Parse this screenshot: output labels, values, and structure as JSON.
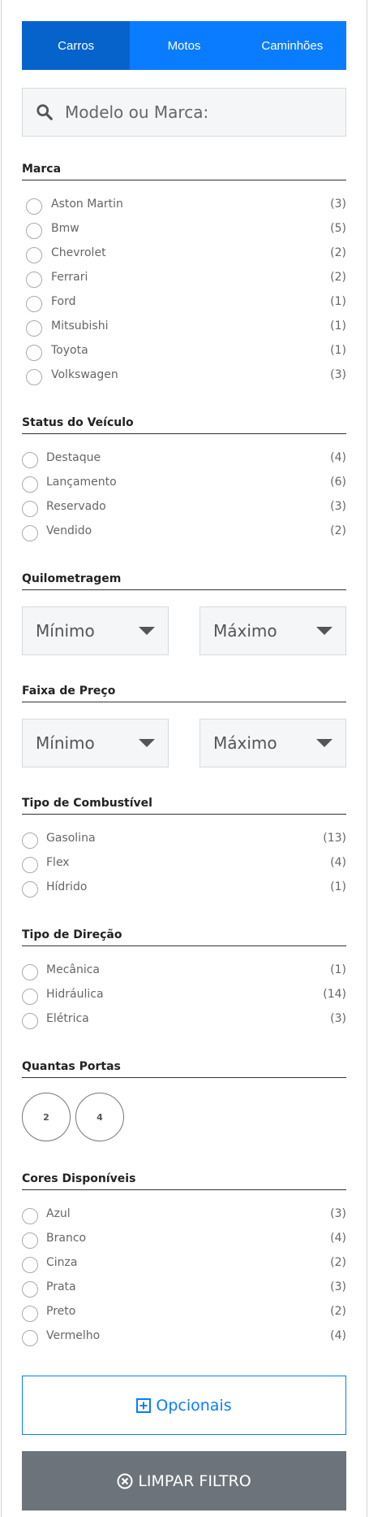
{
  "tabs": [
    {
      "label": "Carros",
      "active": true
    },
    {
      "label": "Motos",
      "active": false
    },
    {
      "label": "Caminhões",
      "active": false
    }
  ],
  "search": {
    "placeholder": "Modelo ou Marca:"
  },
  "sections": {
    "marca": {
      "title": "Marca",
      "items": [
        {
          "label": "Aston Martin",
          "count": "(3)"
        },
        {
          "label": "Bmw",
          "count": "(5)"
        },
        {
          "label": "Chevrolet",
          "count": "(2)"
        },
        {
          "label": "Ferrari",
          "count": "(2)"
        },
        {
          "label": "Ford",
          "count": "(1)"
        },
        {
          "label": "Mitsubishi",
          "count": "(1)"
        },
        {
          "label": "Toyota",
          "count": "(1)"
        },
        {
          "label": "Volkswagen",
          "count": "(3)"
        }
      ]
    },
    "status": {
      "title": "Status do Veículo",
      "items": [
        {
          "label": "Destaque",
          "count": "(4)"
        },
        {
          "label": "Lançamento",
          "count": "(6)"
        },
        {
          "label": "Reservado",
          "count": "(3)"
        },
        {
          "label": "Vendido",
          "count": "(2)"
        }
      ]
    },
    "quilometragem": {
      "title": "Quilometragem",
      "min": "Mínimo",
      "max": "Máximo"
    },
    "preco": {
      "title": "Faixa de Preço",
      "min": "Mínimo",
      "max": "Máximo"
    },
    "combustivel": {
      "title": "Tipo de Combustível",
      "items": [
        {
          "label": "Gasolina",
          "count": "(13)"
        },
        {
          "label": "Flex",
          "count": "(4)"
        },
        {
          "label": "Hídrido",
          "count": "(1)"
        }
      ]
    },
    "direcao": {
      "title": "Tipo de Direção",
      "items": [
        {
          "label": "Mecânica",
          "count": "(1)"
        },
        {
          "label": "Hidráulica",
          "count": "(14)"
        },
        {
          "label": "Elétrica",
          "count": "(3)"
        }
      ]
    },
    "portas": {
      "title": "Quantas Portas",
      "options": [
        "2",
        "4"
      ]
    },
    "cores": {
      "title": "Cores Disponíveis",
      "items": [
        {
          "label": "Azul",
          "count": "(3)"
        },
        {
          "label": "Branco",
          "count": "(4)"
        },
        {
          "label": "Cinza",
          "count": "(2)"
        },
        {
          "label": "Prata",
          "count": "(3)"
        },
        {
          "label": "Preto",
          "count": "(2)"
        },
        {
          "label": "Vermelho",
          "count": "(4)"
        }
      ]
    }
  },
  "buttons": {
    "opcionais": "Opcionais",
    "limpar": "LIMPAR FILTRO"
  },
  "colors": {
    "accent": "#0a7cff",
    "accent_dark": "#0763cc",
    "clear_bg": "#6c737b"
  },
  "icons": {
    "search": "search-icon",
    "opcionais": "plus-square-icon",
    "limpar": "times-circle-icon"
  }
}
